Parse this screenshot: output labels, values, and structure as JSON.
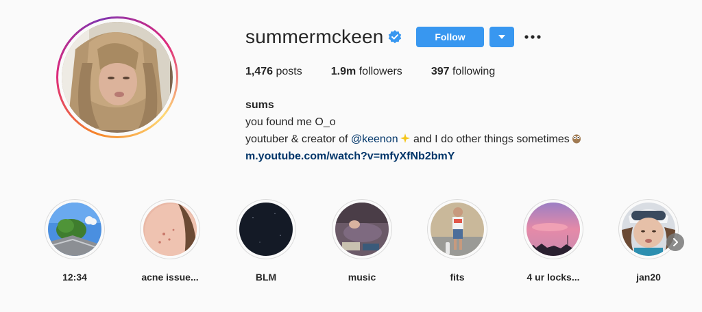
{
  "profile": {
    "username": "summermckeen",
    "verified": true,
    "follow_label": "Follow",
    "stats": {
      "posts_count": "1,476",
      "posts_label": "posts",
      "followers_count": "1.9m",
      "followers_label": "followers",
      "following_count": "397",
      "following_label": "following"
    },
    "bio": {
      "name": "sums",
      "line1": "you found me O_o",
      "line2_prefix": "youtuber & creator of ",
      "mention": "@keenon",
      "line2_suffix": " and I do other things sometimes",
      "link": "m.youtube.com/watch?v=mfyXfNb2bmY"
    }
  },
  "highlights": [
    {
      "label": "12:34"
    },
    {
      "label": "acne issue..."
    },
    {
      "label": "BLM"
    },
    {
      "label": "music"
    },
    {
      "label": "fits"
    },
    {
      "label": "4 ur locks..."
    },
    {
      "label": "jan20"
    }
  ],
  "colors": {
    "accent": "#3897f0",
    "link": "#003569",
    "text": "#262626",
    "background": "#fafafa"
  },
  "icons": {
    "verified": "verified-badge-icon",
    "dropdown": "caret-down-icon",
    "more": "ellipsis-icon",
    "next": "chevron-right-icon"
  }
}
